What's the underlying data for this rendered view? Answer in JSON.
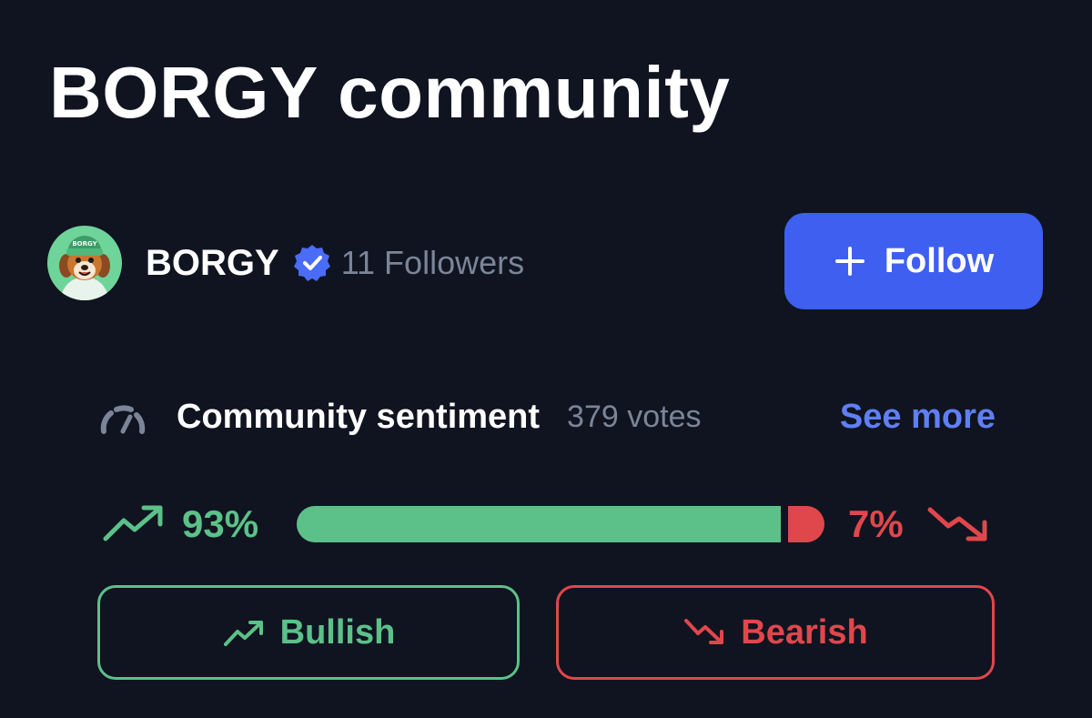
{
  "page": {
    "title": "BORGY community"
  },
  "profile": {
    "avatar_text": "BORGY",
    "handle": "BORGY",
    "verified": true,
    "followers_text": "11 Followers",
    "follow_label": "Follow"
  },
  "sentiment": {
    "title": "Community sentiment",
    "votes_text": "379 votes",
    "see_more_label": "See more",
    "bullish_pct_text": "93%",
    "bearish_pct_text": "7%",
    "bullish_fraction": 0.93,
    "bearish_fraction": 0.07,
    "bullish_label": "Bullish",
    "bearish_label": "Bearish"
  },
  "icons": {
    "verified": "verified-badge-icon",
    "follow": "plus-icon",
    "sentiment": "gauge-icon",
    "bullish": "trend-up-icon",
    "bearish": "trend-down-icon"
  },
  "colors": {
    "background": "#0f1420",
    "accent_blue": "#3f5ff0",
    "link_blue": "#5f7ff5",
    "bullish_green": "#5cc189",
    "bearish_red": "#e0474c",
    "muted_text": "#7c8598"
  }
}
